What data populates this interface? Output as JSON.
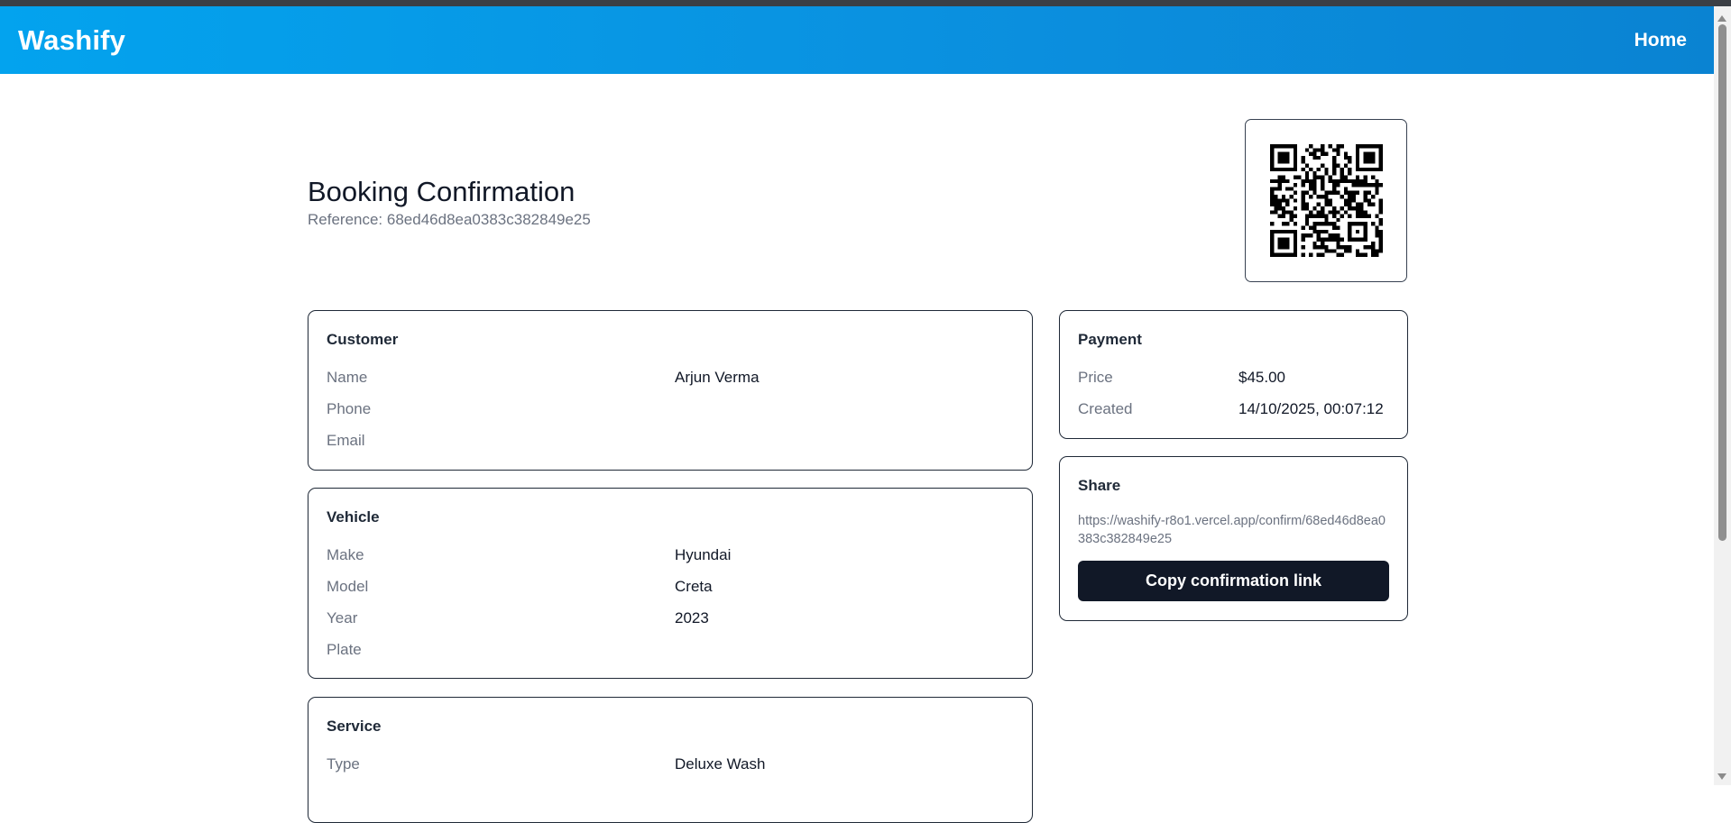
{
  "navbar": {
    "brand": "Washify",
    "home_label": "Home"
  },
  "header": {
    "title": "Booking Confirmation",
    "reference": "Reference: 68ed46d8ea0383c382849e25"
  },
  "customer": {
    "title": "Customer",
    "rows": [
      {
        "label": "Name",
        "value": "Arjun Verma"
      },
      {
        "label": "Phone",
        "value": ""
      },
      {
        "label": "Email",
        "value": ""
      }
    ]
  },
  "vehicle": {
    "title": "Vehicle",
    "rows": [
      {
        "label": "Make",
        "value": "Hyundai"
      },
      {
        "label": "Model",
        "value": "Creta"
      },
      {
        "label": "Year",
        "value": "2023"
      },
      {
        "label": "Plate",
        "value": ""
      }
    ]
  },
  "service": {
    "title": "Service",
    "rows": [
      {
        "label": "Type",
        "value": "Deluxe Wash"
      }
    ]
  },
  "payment": {
    "title": "Payment",
    "rows": [
      {
        "label": "Price",
        "value": "$45.00"
      },
      {
        "label": "Created",
        "value": "14/10/2025, 00:07:12"
      }
    ]
  },
  "share": {
    "title": "Share",
    "url": "https://washify-r8o1.vercel.app/confirm/68ed46d8ea0383c382849e25",
    "button_label": "Copy confirmation link"
  },
  "icons": {
    "qr": "qr-code-icon"
  }
}
